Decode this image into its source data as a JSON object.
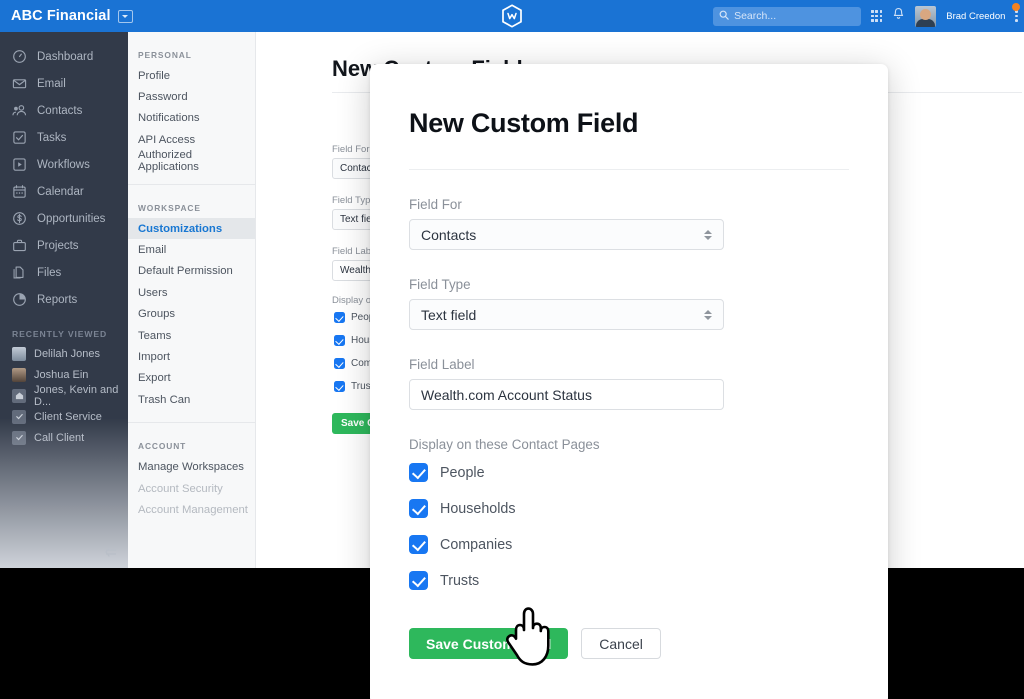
{
  "topbar": {
    "brand": "ABC Financial",
    "brand_caret_icon": "chevron-down-icon",
    "logo_icon": "wealthbox-hexagon-logo",
    "search_placeholder": "Search...",
    "search_icon": "search-icon",
    "apps_icon": "grid-apps-icon",
    "bell_icon": "bell-icon",
    "avatar_icon": "user-avatar",
    "user_name": "Brad Creedon",
    "kebab_icon": "vertical-dots-icon",
    "accent_color": "#1a73d4"
  },
  "sidebar": {
    "items": [
      {
        "label": "Dashboard",
        "icon": "gauge-icon"
      },
      {
        "label": "Email",
        "icon": "envelope-icon"
      },
      {
        "label": "Contacts",
        "icon": "people-icon"
      },
      {
        "label": "Tasks",
        "icon": "checkbox-icon"
      },
      {
        "label": "Workflows",
        "icon": "play-square-icon"
      },
      {
        "label": "Calendar",
        "icon": "calendar-icon"
      },
      {
        "label": "Opportunities",
        "icon": "dollar-circle-icon"
      },
      {
        "label": "Projects",
        "icon": "briefcase-icon"
      },
      {
        "label": "Files",
        "icon": "files-icon"
      },
      {
        "label": "Reports",
        "icon": "pie-chart-icon"
      }
    ],
    "recently_viewed_title": "RECENTLY VIEWED",
    "recently_viewed": [
      {
        "label": "Delilah Jones",
        "icon": "contact-photo"
      },
      {
        "label": "Joshua Ein",
        "icon": "contact-photo"
      },
      {
        "label": "Jones, Kevin and D...",
        "icon": "household-icon"
      },
      {
        "label": "Client Service",
        "icon": "task-check-icon"
      },
      {
        "label": "Call Client",
        "icon": "task-check-icon"
      }
    ],
    "collapse_icon": "collapse-sidebar-icon",
    "background_color": "#323a49"
  },
  "settings_nav": {
    "sections": [
      {
        "title": "PERSONAL",
        "items": [
          {
            "label": "Profile",
            "state": "normal"
          },
          {
            "label": "Password",
            "state": "normal"
          },
          {
            "label": "Notifications",
            "state": "normal"
          },
          {
            "label": "API Access",
            "state": "normal"
          },
          {
            "label": "Authorized Applications",
            "state": "normal"
          }
        ]
      },
      {
        "title": "WORKSPACE",
        "items": [
          {
            "label": "Customizations",
            "state": "active"
          },
          {
            "label": "Email",
            "state": "normal"
          },
          {
            "label": "Default Permission",
            "state": "normal"
          },
          {
            "label": "Users",
            "state": "normal"
          },
          {
            "label": "Groups",
            "state": "normal"
          },
          {
            "label": "Teams",
            "state": "normal"
          },
          {
            "label": "Import",
            "state": "normal"
          },
          {
            "label": "Export",
            "state": "normal"
          },
          {
            "label": "Trash Can",
            "state": "normal"
          }
        ]
      },
      {
        "title": "ACCOUNT",
        "items": [
          {
            "label": "Manage Workspaces",
            "state": "normal"
          },
          {
            "label": "Account Security",
            "state": "disabled"
          },
          {
            "label": "Account Management",
            "state": "disabled"
          }
        ]
      }
    ],
    "active_color": "#1877d2"
  },
  "background_page": {
    "title": "New Custom Field",
    "field_for_label": "Field For",
    "field_for_value": "Contacts",
    "field_type_label": "Field Type",
    "field_type_value": "Text field",
    "field_label_label": "Field Label",
    "field_label_value": "Wealth.com Account Status",
    "display_label": "Display on these Contact Pages",
    "checkboxes": [
      "People",
      "Households",
      "Companies",
      "Trusts"
    ],
    "save_label": "Save Custom Field"
  },
  "modal": {
    "title": "New Custom Field",
    "field_for": {
      "label": "Field For",
      "value": "Contacts",
      "options": [
        "Contacts"
      ],
      "arrows_icon": "select-stepper-arrows-icon"
    },
    "field_type": {
      "label": "Field Type",
      "value": "Text field",
      "options": [
        "Text field"
      ],
      "arrows_icon": "select-stepper-arrows-icon"
    },
    "field_label": {
      "label": "Field Label",
      "value": "Wealth.com Account Status",
      "placeholder": "Field Label"
    },
    "display_group": {
      "label": "Display on these Contact Pages",
      "options": [
        {
          "label": "People",
          "checked": true
        },
        {
          "label": "Households",
          "checked": true
        },
        {
          "label": "Companies",
          "checked": true
        },
        {
          "label": "Trusts",
          "checked": true
        }
      ]
    },
    "save_button": "Save Custom Field",
    "cancel_button": "Cancel",
    "save_color": "#2eb85c",
    "checkbox_color": "#1877f2"
  },
  "cursor": {
    "icon": "pointing-hand-cursor"
  }
}
